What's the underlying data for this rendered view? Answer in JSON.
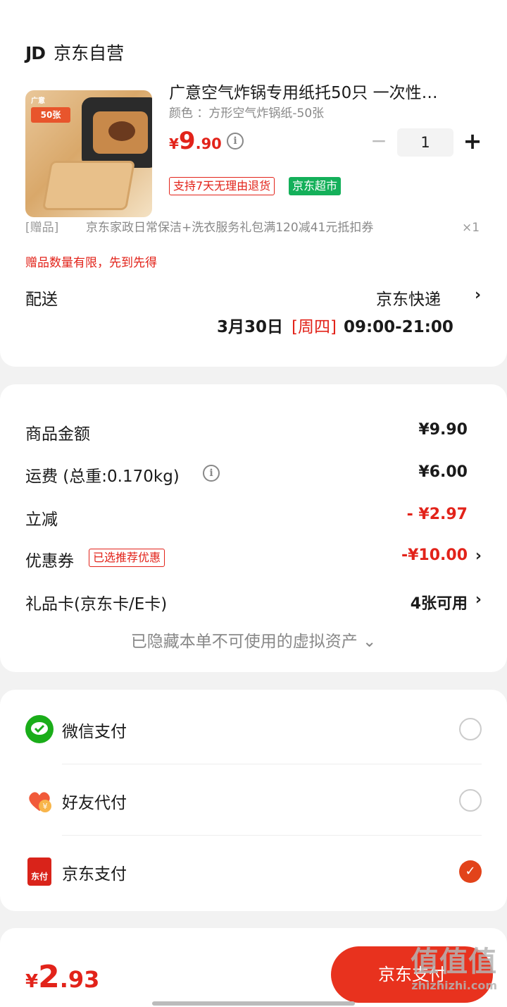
{
  "store": {
    "logo": "JD",
    "name": "京东自营"
  },
  "product": {
    "title": "广意空气炸锅专用纸托50只 一次性…",
    "spec": "颜色 ：方形空气炸锅纸-50张",
    "price_currency": "¥",
    "price_int": "9",
    "price_dec": ".90",
    "quantity": "1",
    "qty_minus": "−",
    "qty_plus": "+",
    "tags": [
      "支持7天无理由退货",
      "京东超市"
    ],
    "image_badge": "50张",
    "image_brand": "广意"
  },
  "gift": {
    "tag": "[赠品]",
    "text": "京东家政日常保洁+洗衣服务礼包满120减41元抵扣券",
    "qty": "×1",
    "limit_note": "赠品数量有限，先到先得"
  },
  "delivery": {
    "label": "配送",
    "method": "京东快递",
    "date": "3月30日",
    "weekday": "[周四]",
    "time": "09:00-21:00"
  },
  "summary": {
    "rows": [
      {
        "label": "商品金额",
        "value": "¥9.90"
      },
      {
        "label": "运费 (总重:0.170kg)",
        "value": "¥6.00"
      },
      {
        "label": "立减",
        "value": "- ¥2.97"
      },
      {
        "label": "优惠券",
        "tag": "已选推荐优惠",
        "value": "-¥10.00"
      },
      {
        "label": "礼品卡(京东卡/E卡)",
        "value": "4张可用"
      }
    ],
    "hidden_note": "已隐藏本单不可使用的虚拟资产 ⌄"
  },
  "payment": {
    "options": [
      {
        "label": "微信支付",
        "icon": "wechat-icon",
        "selected": false
      },
      {
        "label": "好友代付",
        "icon": "friend-pay-icon",
        "selected": false
      },
      {
        "label": "京东支付",
        "icon": "jd-pay-icon",
        "selected": true
      }
    ],
    "jd_pay_icon_text": "东付"
  },
  "footer": {
    "total_currency": "¥",
    "total_int": "2",
    "total_dec": ".93",
    "submit_label": "京东支付",
    "watermark": "值值值",
    "watermark_url": "zhizhizhi.com"
  },
  "colors": {
    "accent": "#e2231a",
    "wechat": "#1aad19",
    "market_tag": "#14b05a"
  }
}
